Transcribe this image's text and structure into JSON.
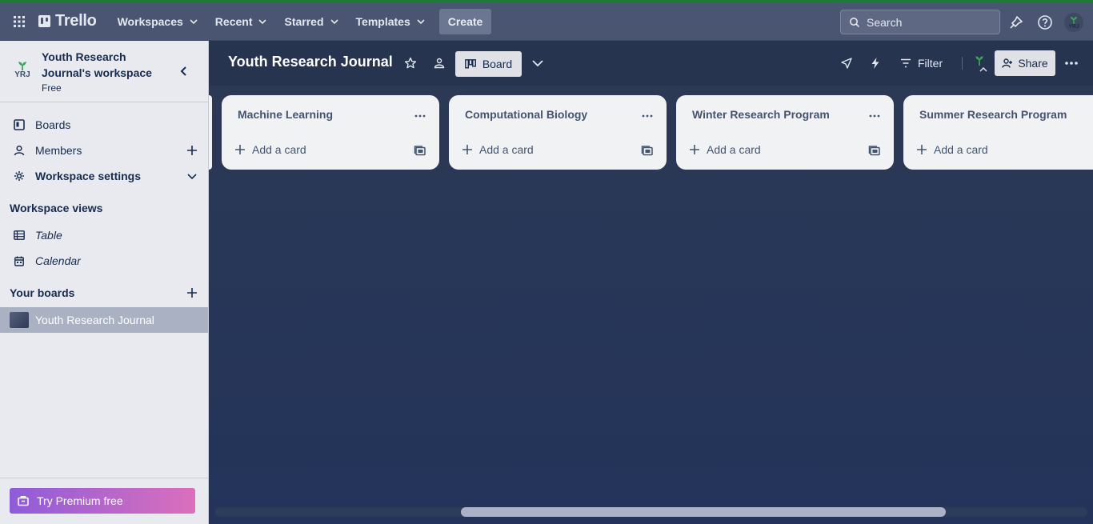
{
  "topbar": {
    "logo_text": "Trello",
    "nav": [
      {
        "label": "Workspaces"
      },
      {
        "label": "Recent"
      },
      {
        "label": "Starred"
      },
      {
        "label": "Templates"
      }
    ],
    "create_label": "Create",
    "search_placeholder": "Search",
    "avatar_initials": "YRJ"
  },
  "sidebar": {
    "workspace_name": "Youth Research Journal's workspace",
    "workspace_plan": "Free",
    "workspace_initials": "YRJ",
    "items": [
      {
        "label": "Boards",
        "icon": "board-icon"
      },
      {
        "label": "Members",
        "icon": "person-icon"
      },
      {
        "label": "Workspace settings",
        "icon": "gear-icon"
      }
    ],
    "views_heading": "Workspace views",
    "views": [
      {
        "label": "Table",
        "icon": "table-icon"
      },
      {
        "label": "Calendar",
        "icon": "calendar-icon"
      }
    ],
    "boards_heading": "Your boards",
    "boards": [
      {
        "label": "Youth Research Journal"
      }
    ],
    "premium_label": "Try Premium free"
  },
  "board": {
    "title": "Youth Research Journal",
    "view_label": "Board",
    "filter_label": "Filter",
    "share_label": "Share",
    "lists": [
      {
        "title": "Machine Learning",
        "add_label": "Add a card"
      },
      {
        "title": "Computational Biology",
        "add_label": "Add a card"
      },
      {
        "title": "Winter Research Program",
        "add_label": "Add a card"
      },
      {
        "title": "Summer Research Program",
        "add_label": "Add a card"
      }
    ]
  },
  "colors": {
    "topbar": "#4a5671",
    "sidebar": "#e9eaef",
    "board_bg": "#26345a",
    "list_bg": "#f1f2f4",
    "premium_start": "#8e5cd9",
    "premium_end": "#db6fbc"
  }
}
